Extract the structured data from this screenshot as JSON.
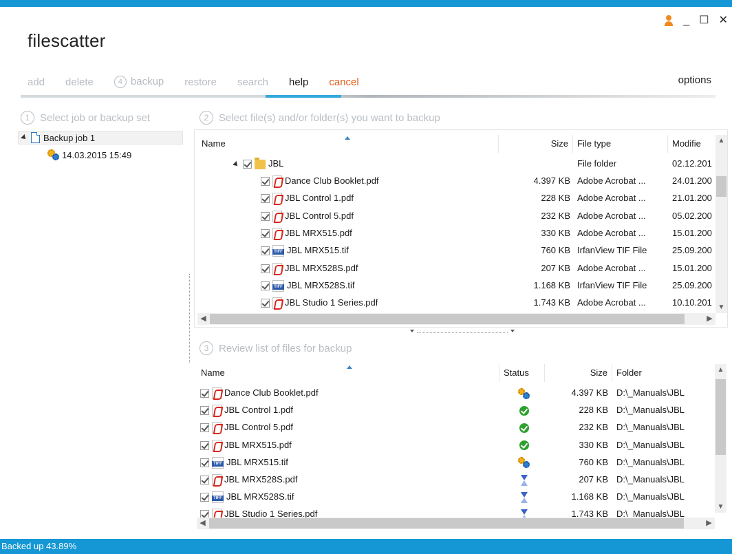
{
  "app": {
    "title": "filescatter"
  },
  "window": {
    "minimize": "_",
    "maximize": "☐",
    "close": "✕"
  },
  "menu": {
    "add": "add",
    "delete": "delete",
    "backup_num": "4",
    "backup": "backup",
    "restore": "restore",
    "search": "search",
    "help": "help",
    "cancel": "cancel",
    "options": "options"
  },
  "step1": {
    "num": "1",
    "title": "Select job or backup set",
    "job": "Backup job 1",
    "set": "14.03.2015 15:49"
  },
  "step2": {
    "num": "2",
    "title": "Select file(s) and/or folder(s) you want to backup",
    "columns": {
      "name": "Name",
      "size": "Size",
      "type": "File type",
      "modified": "Modifie"
    },
    "folder": {
      "name": "JBL",
      "type": "File folder",
      "modified": "02.12.201"
    },
    "files": [
      {
        "name": "Dance Club Booklet.pdf",
        "icon": "pdf",
        "size": "4.397 KB",
        "type": "Adobe Acrobat ...",
        "modified": "24.01.200"
      },
      {
        "name": "JBL Control 1.pdf",
        "icon": "pdf",
        "size": "228 KB",
        "type": "Adobe Acrobat ...",
        "modified": "21.01.200"
      },
      {
        "name": "JBL Control 5.pdf",
        "icon": "pdf",
        "size": "232 KB",
        "type": "Adobe Acrobat ...",
        "modified": "05.02.200"
      },
      {
        "name": "JBL MRX515.pdf",
        "icon": "pdf",
        "size": "330 KB",
        "type": "Adobe Acrobat ...",
        "modified": "15.01.200"
      },
      {
        "name": "JBL MRX515.tif",
        "icon": "tiff",
        "size": "760 KB",
        "type": "IrfanView TIF File",
        "modified": "25.09.200"
      },
      {
        "name": "JBL MRX528S.pdf",
        "icon": "pdf",
        "size": "207 KB",
        "type": "Adobe Acrobat ...",
        "modified": "15.01.200"
      },
      {
        "name": "JBL MRX528S.tif",
        "icon": "tiff",
        "size": "1.168 KB",
        "type": "IrfanView TIF File",
        "modified": "25.09.200"
      },
      {
        "name": "JBL Studio 1 Series.pdf",
        "icon": "pdf",
        "size": "1.743 KB",
        "type": "Adobe Acrobat ...",
        "modified": "10.10.201"
      }
    ]
  },
  "step3": {
    "num": "3",
    "title": "Review list of files for backup",
    "columns": {
      "name": "Name",
      "status": "Status",
      "size": "Size",
      "folder": "Folder"
    },
    "files": [
      {
        "name": "Dance Club Booklet.pdf",
        "icon": "pdf",
        "status": "in-progress",
        "size": "4.397 KB",
        "folder": "D:\\_Manuals\\JBL"
      },
      {
        "name": "JBL Control 1.pdf",
        "icon": "pdf",
        "status": "done",
        "size": "228 KB",
        "folder": "D:\\_Manuals\\JBL"
      },
      {
        "name": "JBL Control 5.pdf",
        "icon": "pdf",
        "status": "done",
        "size": "232 KB",
        "folder": "D:\\_Manuals\\JBL"
      },
      {
        "name": "JBL MRX515.pdf",
        "icon": "pdf",
        "status": "done",
        "size": "330 KB",
        "folder": "D:\\_Manuals\\JBL"
      },
      {
        "name": "JBL MRX515.tif",
        "icon": "tiff",
        "status": "in-progress",
        "size": "760 KB",
        "folder": "D:\\_Manuals\\JBL"
      },
      {
        "name": "JBL MRX528S.pdf",
        "icon": "pdf",
        "status": "waiting",
        "size": "207 KB",
        "folder": "D:\\_Manuals\\JBL"
      },
      {
        "name": "JBL MRX528S.tif",
        "icon": "tiff",
        "status": "waiting",
        "size": "1.168 KB",
        "folder": "D:\\_Manuals\\JBL"
      },
      {
        "name": "JBL Studio 1 Series.pdf",
        "icon": "pdf",
        "status": "waiting",
        "size": "1.743 KB",
        "folder": "D:\\_Manuals\\JBL"
      }
    ]
  },
  "statusbar": {
    "text": "Backed up 43.89%"
  },
  "colors": {
    "accent": "#1497d4",
    "cancel": "#e05c1e",
    "user": "#f08a1c"
  }
}
